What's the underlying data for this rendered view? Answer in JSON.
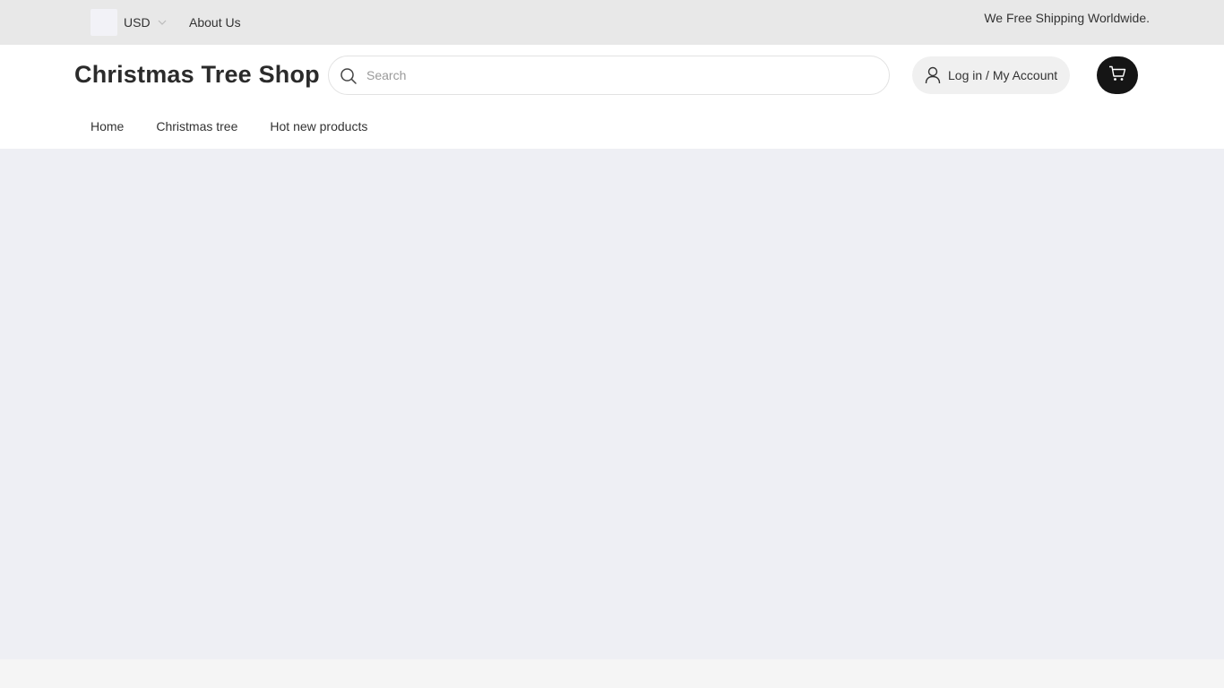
{
  "topbar": {
    "currency_label": "USD",
    "about_label": "About Us",
    "shipping_text": "We Free Shipping Worldwide.",
    "currency_icon": "chevron-down-icon"
  },
  "header": {
    "logo_text": "Christmas Tree Shop",
    "search": {
      "placeholder": "Search",
      "value": "",
      "icon": "search-icon"
    },
    "account": {
      "label": "Log in / My Account",
      "icon": "user-icon"
    },
    "cart": {
      "icon": "cart-icon"
    }
  },
  "nav": {
    "items": [
      {
        "label": "Home"
      },
      {
        "label": "Christmas tree"
      },
      {
        "label": "Hot new products"
      }
    ]
  },
  "colors": {
    "topbar_bg": "#e8e8e8",
    "header_bg": "#ffffff",
    "main_bg": "#eeeff4",
    "cart_bg": "#151515",
    "account_bg": "#f0f0f0"
  }
}
